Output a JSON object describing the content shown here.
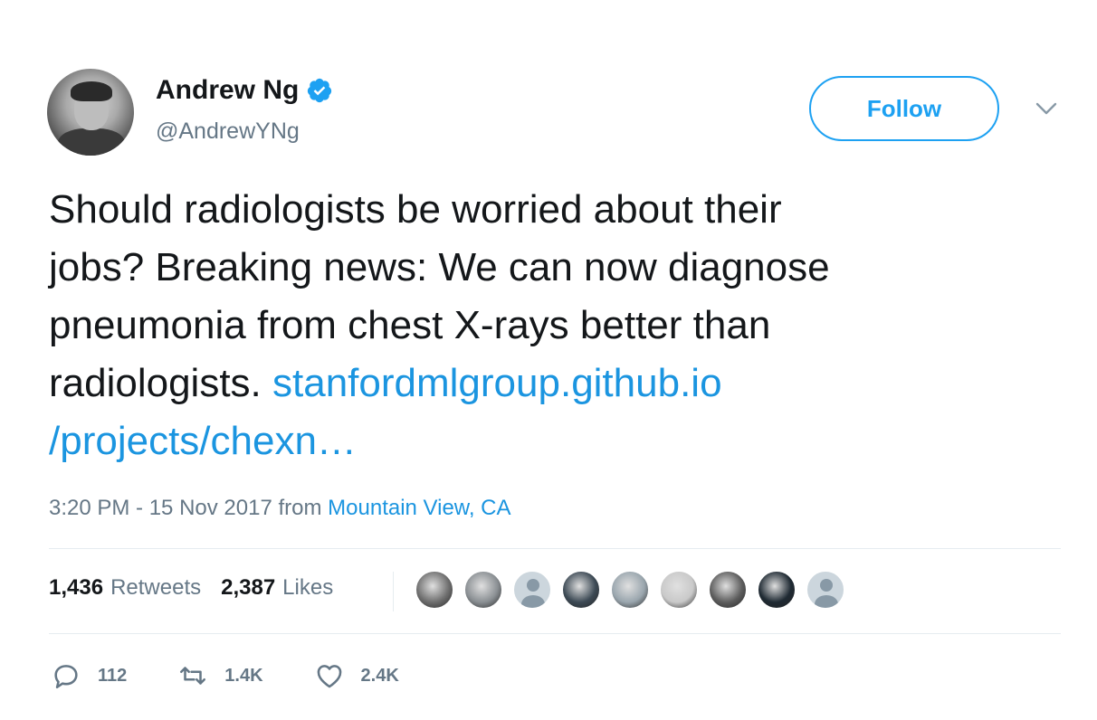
{
  "author": {
    "name": "Andrew Ng",
    "handle": "@AndrewYNg",
    "verified": true
  },
  "follow_button": {
    "label": "Follow"
  },
  "tweet": {
    "lines": [
      "Should radiologists be worried about their",
      "jobs? Breaking news: We can now diagnose",
      "pneumonia from chest X-rays better than",
      "radiologists."
    ],
    "link_part1": "stanfordmlgroup.github.io",
    "link_part2": "/projects/chexn…"
  },
  "meta": {
    "timestamp": "3:20 PM - 15 Nov 2017",
    "from": "from",
    "location": "Mountain View, CA"
  },
  "stats": {
    "retweets_count": "1,436",
    "retweets_label": "Retweets",
    "likes_count": "2,387",
    "likes_label": "Likes"
  },
  "likers": [
    {
      "kind": "photo",
      "color": "#6e6e6e"
    },
    {
      "kind": "photo",
      "color": "#8a8f93"
    },
    {
      "kind": "default",
      "color": "#ccd6dd"
    },
    {
      "kind": "photo",
      "color": "#3d4a55"
    },
    {
      "kind": "photo",
      "color": "#9aa6ae"
    },
    {
      "kind": "photo",
      "color": "#c9c9c9"
    },
    {
      "kind": "photo",
      "color": "#5d5d5d"
    },
    {
      "kind": "photo",
      "color": "#1f2a33"
    },
    {
      "kind": "default",
      "color": "#ccd6dd"
    }
  ],
  "actions": {
    "replies": "112",
    "retweets": "1.4K",
    "likes": "2.4K"
  },
  "colors": {
    "accent": "#1da1f2",
    "link": "#1b95e0",
    "secondary_text": "#657786"
  }
}
